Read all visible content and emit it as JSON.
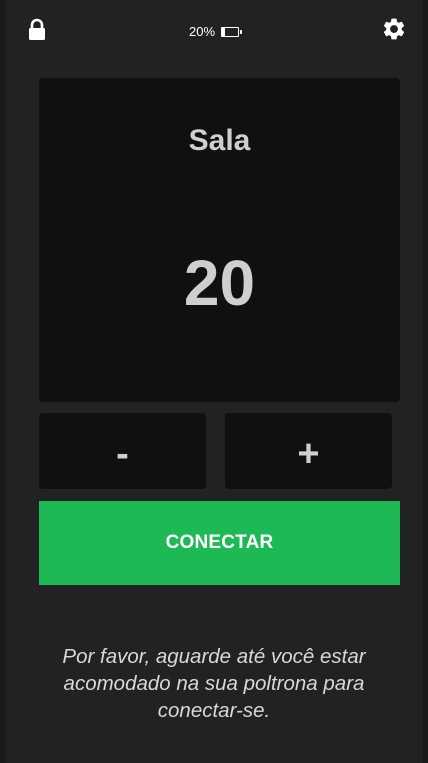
{
  "status": {
    "battery_text": "20%",
    "battery_level": 0.2,
    "lock_icon": "lock-icon",
    "settings_icon": "gear-icon"
  },
  "room": {
    "label": "Sala",
    "number": "20"
  },
  "controls": {
    "decrement_label": "-",
    "increment_label": "+",
    "connect_label": "CONECTAR"
  },
  "message": {
    "text": "Por favor, aguarde até você estar acomodado na sua poltrona para conectar-se."
  },
  "colors": {
    "background": "#222222",
    "card": "#101010",
    "accent": "#1db954",
    "text": "#cfcfcf"
  }
}
